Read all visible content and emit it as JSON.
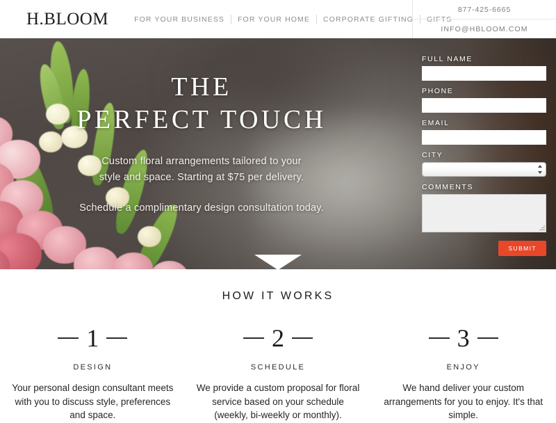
{
  "header": {
    "logo": "H.BLOOM",
    "nav": [
      {
        "label": "FOR YOUR BUSINESS"
      },
      {
        "label": "FOR YOUR HOME"
      },
      {
        "label": "CORPORATE GIFTING"
      },
      {
        "label": "GIFTS"
      }
    ],
    "phone": "877-425-6665",
    "email": "INFO@HBLOOM.COM"
  },
  "hero": {
    "title_line1": "THE",
    "title_line2": "PERFECT TOUCH",
    "sub_line1": "Custom floral arrangements tailored to your",
    "sub_line2": "style and space. Starting at $75 per delivery.",
    "sub_line3": "Schedule a complimentary design consultation today."
  },
  "form": {
    "fields": [
      {
        "label": "FULL NAME",
        "value": "",
        "placeholder": ""
      },
      {
        "label": "PHONE",
        "value": "",
        "placeholder": ""
      },
      {
        "label": "EMAIL",
        "value": "",
        "placeholder": ""
      }
    ],
    "city": {
      "label": "CITY",
      "value": "",
      "options": [
        ""
      ]
    },
    "comments": {
      "label": "COMMENTS",
      "value": "",
      "placeholder": ""
    },
    "submit_label": "SUBMIT",
    "submit_color": "#e8472a"
  },
  "works": {
    "title": "HOW IT WORKS",
    "steps": [
      {
        "number": "1",
        "label": "DESIGN",
        "desc": "Your personal design consultant meets with you to discuss style, preferences and space."
      },
      {
        "number": "2",
        "label": "SCHEDULE",
        "desc": "We provide a custom proposal for floral service based on your schedule (weekly, bi-weekly or monthly)."
      },
      {
        "number": "3",
        "label": "ENJOY",
        "desc": "We hand deliver your custom arrangements for you to enjoy. It's that simple."
      }
    ]
  }
}
